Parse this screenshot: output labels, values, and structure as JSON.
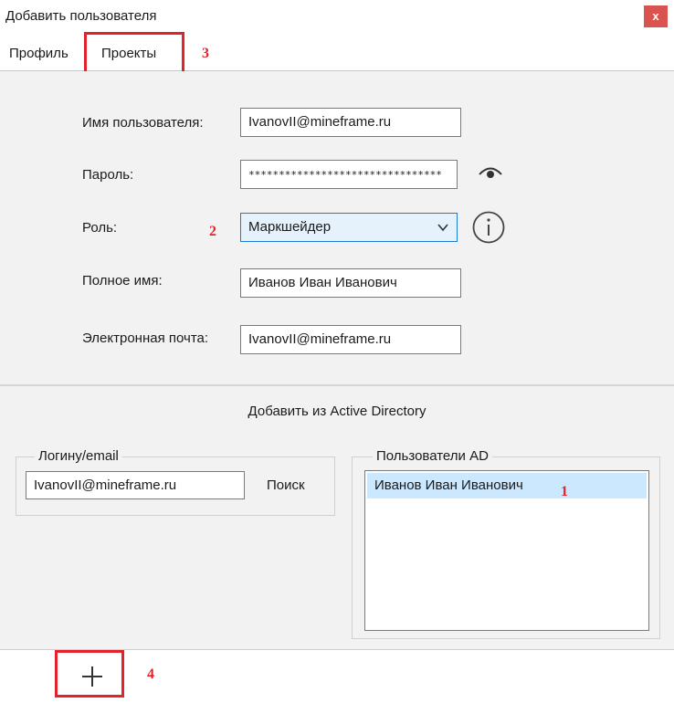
{
  "window": {
    "title": "Добавить пользователя",
    "close_label": "x"
  },
  "tabs": [
    {
      "label": "Профиль"
    },
    {
      "label": "Проекты"
    }
  ],
  "form": {
    "username": {
      "label": "Имя пользователя:",
      "value": "IvanovII@mineframe.ru"
    },
    "password": {
      "label": "Пароль:",
      "value": "********************************"
    },
    "role": {
      "label": "Роль:",
      "value": "Маркшейдер"
    },
    "full_name": {
      "label": "Полное имя:",
      "value": "Иванов Иван Иванович"
    },
    "email": {
      "label": "Электронная почта:",
      "value": "IvanovII@mineframe.ru"
    }
  },
  "ad": {
    "section_title": "Добавить из Active Directory",
    "login_group_title": "Логину/email",
    "login_value": "IvanovII@mineframe.ru",
    "search_label": "Поиск",
    "users_group_title": "Пользователи AD",
    "users": [
      "Иванов Иван Иванович"
    ]
  },
  "annotations": {
    "n1": "1",
    "n2": "2",
    "n3": "3",
    "n4": "4"
  },
  "icons": {
    "eye": "eye-icon",
    "info": "info-icon",
    "chevron": "chevron-down-icon",
    "plus": "plus-icon"
  },
  "colors": {
    "highlight": "#e2232b",
    "close_button": "#d9534f",
    "panel_bg": "#f2f2f2",
    "selected_item": "#cce8ff",
    "select_focus": "#1f7ad1"
  }
}
